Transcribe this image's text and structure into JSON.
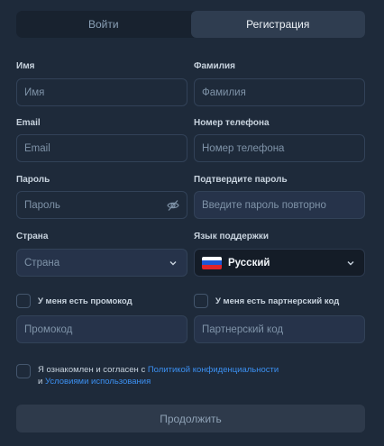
{
  "tabs": [
    {
      "label": "Войти",
      "active": false
    },
    {
      "label": "Регистрация",
      "active": true
    }
  ],
  "form": {
    "first_name": {
      "label": "Имя",
      "placeholder": "Имя"
    },
    "last_name": {
      "label": "Фамилия",
      "placeholder": "Фамилия"
    },
    "email": {
      "label": "Email",
      "placeholder": "Email"
    },
    "phone": {
      "label": "Номер телефона",
      "placeholder": "Номер телефона"
    },
    "password": {
      "label": "Пароль",
      "placeholder": "Пароль"
    },
    "password_confirm": {
      "label": "Подтвердите пароль",
      "placeholder": "Введите пароль повторно"
    },
    "country": {
      "label": "Страна",
      "placeholder": "Страна"
    },
    "language": {
      "label": "Язык поддержки",
      "value": "Русский"
    },
    "promo": {
      "checkbox_label": "У меня есть промокод",
      "placeholder": "Промокод",
      "checked": false
    },
    "partner": {
      "checkbox_label": "У меня есть партнерский код",
      "placeholder": "Партнерский код",
      "checked": false
    }
  },
  "consent": {
    "prefix": "Я ознакомлен и согласен с",
    "privacy_link": "Политикой конфиденциальности",
    "conjunction": "и",
    "terms_link": "Условиями использования",
    "checked": false
  },
  "submit_label": "Продолжить",
  "icons": {
    "password_toggle": "eye-off-icon",
    "dropdown": "chevron-down-icon",
    "language_flag": "russia-flag-icon"
  },
  "colors": {
    "background": "#1e2a3a",
    "link": "#3b8ff0",
    "active_tab": "#2f3d50"
  }
}
